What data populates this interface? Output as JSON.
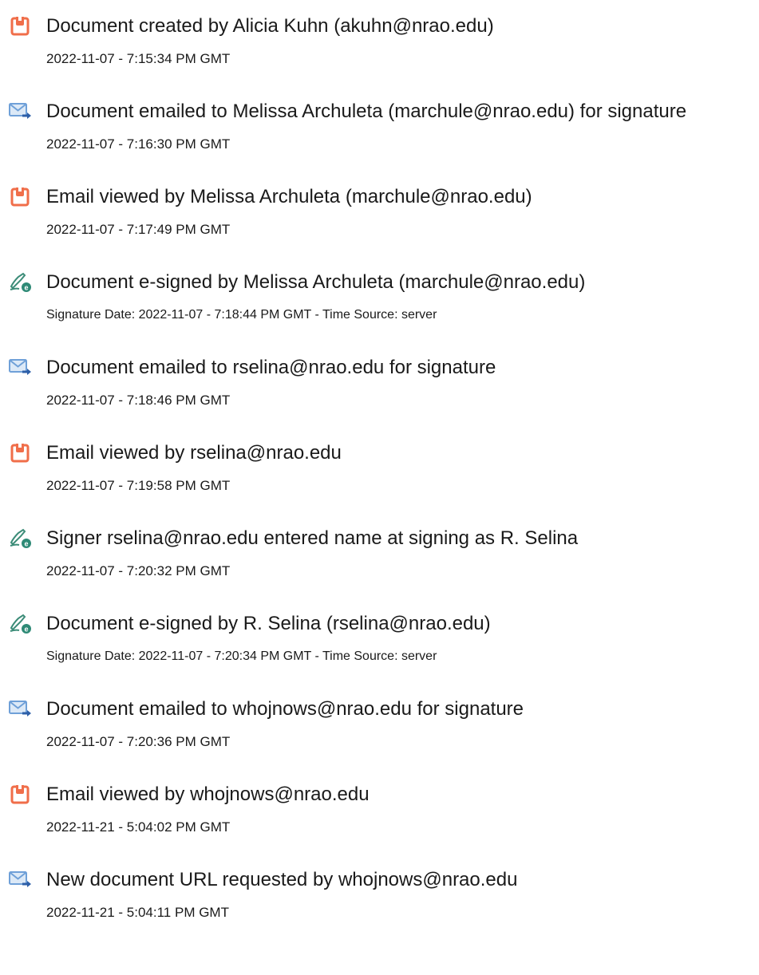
{
  "colors": {
    "created_icon": "#F06E4A",
    "email_icon": "#6FA0D8",
    "email_arrow": "#2D5FA8",
    "sign_icon_pen": "#3C8C78",
    "sign_icon_badge": "#2E8A76"
  },
  "events": [
    {
      "icon": "document-icon",
      "title": "Document created by Alicia Kuhn (akuhn@nrao.edu)",
      "time": "2022-11-07 - 7:15:34 PM GMT"
    },
    {
      "icon": "email-icon",
      "title": "Document emailed to Melissa Archuleta (marchule@nrao.edu) for signature",
      "time": "2022-11-07 - 7:16:30 PM GMT"
    },
    {
      "icon": "document-icon",
      "title": "Email viewed by Melissa Archuleta (marchule@nrao.edu)",
      "time": "2022-11-07 - 7:17:49 PM GMT"
    },
    {
      "icon": "esign-icon",
      "title": "Document e-signed by Melissa Archuleta (marchule@nrao.edu)",
      "time": "Signature Date: 2022-11-07 - 7:18:44 PM GMT - Time Source: server"
    },
    {
      "icon": "email-icon",
      "title": "Document emailed to rselina@nrao.edu for signature",
      "time": "2022-11-07 - 7:18:46 PM GMT"
    },
    {
      "icon": "document-icon",
      "title": "Email viewed by rselina@nrao.edu",
      "time": "2022-11-07 - 7:19:58 PM GMT"
    },
    {
      "icon": "esign-icon",
      "title": "Signer rselina@nrao.edu entered name at signing as R. Selina",
      "time": "2022-11-07 - 7:20:32 PM GMT"
    },
    {
      "icon": "esign-icon",
      "title": "Document e-signed by R. Selina (rselina@nrao.edu)",
      "time": "Signature Date: 2022-11-07 - 7:20:34 PM GMT - Time Source: server"
    },
    {
      "icon": "email-icon",
      "title": "Document emailed to whojnows@nrao.edu for signature",
      "time": "2022-11-07 - 7:20:36 PM GMT"
    },
    {
      "icon": "document-icon",
      "title": "Email viewed by whojnows@nrao.edu",
      "time": "2022-11-21 - 5:04:02 PM GMT"
    },
    {
      "icon": "email-icon",
      "title": "New document URL requested by whojnows@nrao.edu",
      "time": "2022-11-21 - 5:04:11 PM GMT"
    }
  ]
}
